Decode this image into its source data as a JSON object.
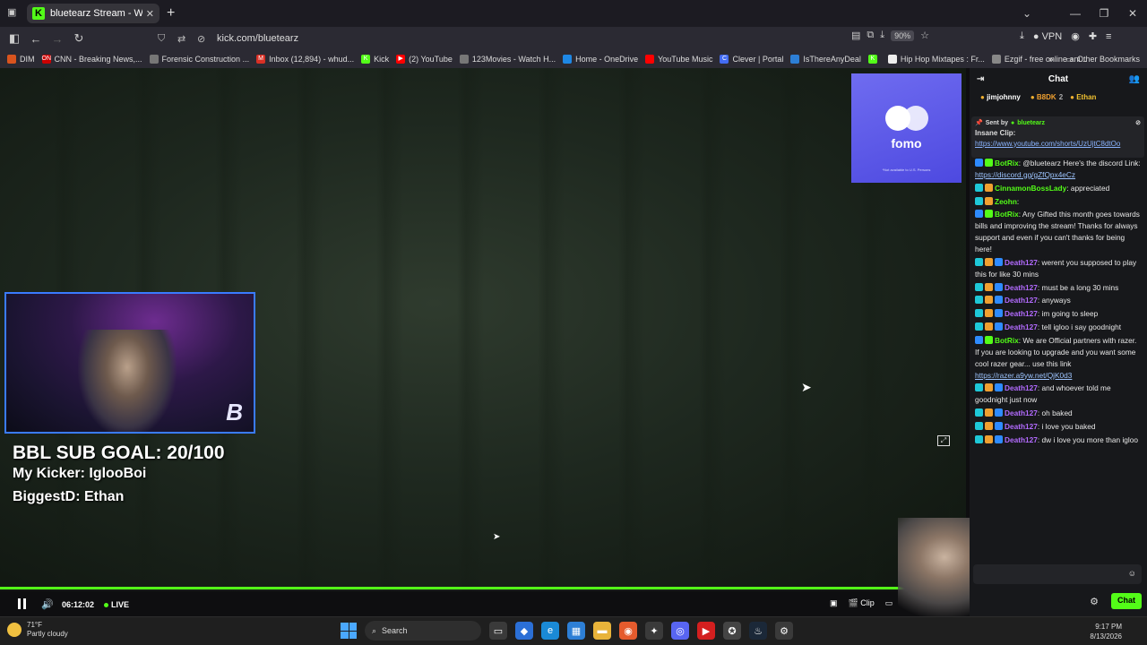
{
  "browser": {
    "tab_title": "bluetearz Stream - Watch L",
    "tab_favicon": "K",
    "url": "kick.com/bluetearz",
    "zoom": "90%",
    "vpn_label": "VPN",
    "bookmarks": [
      {
        "label": "DIM",
        "icon_color": "#d9541e",
        "icon": ""
      },
      {
        "label": "CNN - Breaking News,...",
        "icon_color": "#cc0000",
        "icon": "ON"
      },
      {
        "label": "Forensic Construction ...",
        "icon_color": "#777777",
        "icon": ""
      },
      {
        "label": "Inbox (12,894) - whud...",
        "icon_color": "#d93025",
        "icon": "M"
      },
      {
        "label": "Kick",
        "icon_color": "#53fc18",
        "icon": "K"
      },
      {
        "label": "(2) YouTube",
        "icon_color": "#ff0000",
        "icon": "▶"
      },
      {
        "label": "123Movies - Watch H...",
        "icon_color": "#777777",
        "icon": ""
      },
      {
        "label": "Home - OneDrive",
        "icon_color": "#1e88e5",
        "icon": ""
      },
      {
        "label": "YouTube Music",
        "icon_color": "#ff0000",
        "icon": ""
      },
      {
        "label": "Clever | Portal",
        "icon_color": "#436cf2",
        "icon": "C"
      },
      {
        "label": "IsThereAnyDeal",
        "icon_color": "#2d7fd6",
        "icon": ""
      },
      {
        "label": "",
        "icon_color": "#53fc18",
        "icon": "K"
      },
      {
        "label": "Hip Hop Mixtapes : Fr...",
        "icon_color": "#eeeeee",
        "icon": ""
      },
      {
        "label": "Ezgif - free online ani...",
        "icon_color": "#888888",
        "icon": ""
      }
    ],
    "other_bookmarks": "Other Bookmarks"
  },
  "stream": {
    "ad_brand": "fomo",
    "ad_fine_print": "*Not available to U.S. Persons",
    "overlay_goal": "BBL SUB GOAL: 20/100",
    "overlay_kicker": "My Kicker: IglooBoi",
    "overlay_biggest": "BiggestD: Ethan",
    "webcam_brand": "B",
    "time": "06:12:02",
    "live_label": "LIVE",
    "clip_label": "Clip"
  },
  "chat": {
    "title": "Chat",
    "top_gifters": [
      {
        "name": "jimjohnny",
        "color": "#ffffff",
        "count": ""
      },
      {
        "name": "B8DK",
        "color": "#f0a030",
        "count": "2"
      },
      {
        "name": "Ethan",
        "color": "#f0c030",
        "count": ""
      }
    ],
    "pinned": {
      "sent_by_label": "Sent by",
      "sent_by_user": "bluetearz",
      "label": "Insane Clip:",
      "link": "https://www.youtube.com/shorts/UzUjtC8dtOo"
    },
    "messages": [
      {
        "user": "BotRix",
        "color": "#53fc18",
        "text": "@bluetearz Here's the discord Link: ",
        "link": "https://discord.gg/gZfQpx4eCz"
      },
      {
        "user": "CinnamonBossLady",
        "color": "#53fc18",
        "text": "appreciated",
        "link": ""
      },
      {
        "user": "Zeohn",
        "color": "#53fc18",
        "text": "",
        "link": ""
      },
      {
        "user": "BotRix",
        "color": "#53fc18",
        "text": "Any Gifted this month goes towards bills and improving the stream! Thanks for always support and even if you can't thanks for being here!",
        "link": ""
      },
      {
        "user": "Death127",
        "color": "#b36bff",
        "text": "werent you supposed to play this for like 30 mins",
        "link": ""
      },
      {
        "user": "Death127",
        "color": "#b36bff",
        "text": "must be a long 30 mins",
        "link": ""
      },
      {
        "user": "Death127",
        "color": "#b36bff",
        "text": "anyways",
        "link": ""
      },
      {
        "user": "Death127",
        "color": "#b36bff",
        "text": "im going to sleep",
        "link": ""
      },
      {
        "user": "Death127",
        "color": "#b36bff",
        "text": "tell igloo i say goodnight",
        "link": ""
      },
      {
        "user": "BotRix",
        "color": "#53fc18",
        "text": "We are Official partners with razer. If you are looking to upgrade and you want some cool razer gear... use this link ",
        "link": "https://razer.a9yw.net/QjK0d3"
      },
      {
        "user": "Death127",
        "color": "#b36bff",
        "text": "and whoever told me goodnight just now",
        "link": ""
      },
      {
        "user": "Death127",
        "color": "#b36bff",
        "text": "oh baked",
        "link": ""
      },
      {
        "user": "Death127",
        "color": "#b36bff",
        "text": "i love you baked",
        "link": ""
      },
      {
        "user": "Death127",
        "color": "#b36bff",
        "text": "dw i love you more than igloo",
        "link": ""
      }
    ],
    "send_label": "Chat"
  },
  "taskbar": {
    "temp": "71°F",
    "weather": "Partly cloudy",
    "search": "Search",
    "time": "9:17 PM",
    "date": "8/13/2026"
  }
}
